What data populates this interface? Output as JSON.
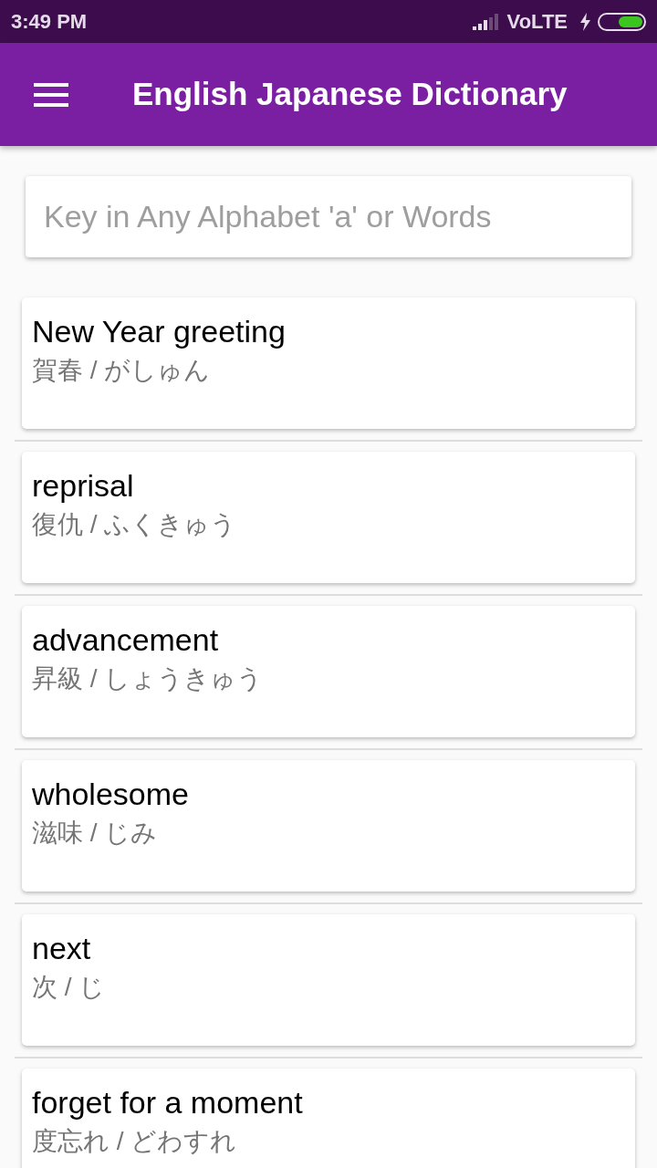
{
  "status_bar": {
    "time": "3:49 PM",
    "network": "VoLTE"
  },
  "app_bar": {
    "title": "English Japanese Dictionary"
  },
  "search": {
    "placeholder": "Key in Any Alphabet 'a' or Words"
  },
  "entries": [
    {
      "word": "New Year greeting",
      "reading": "賀春 / がしゅん"
    },
    {
      "word": "reprisal",
      "reading": "復仇 / ふくきゅう"
    },
    {
      "word": "advancement",
      "reading": "昇級 / しょうきゅう"
    },
    {
      "word": "wholesome",
      "reading": "滋味 / じみ"
    },
    {
      "word": "next",
      "reading": "次 / じ"
    },
    {
      "word": "forget for a moment",
      "reading": "度忘れ / どわすれ"
    }
  ]
}
